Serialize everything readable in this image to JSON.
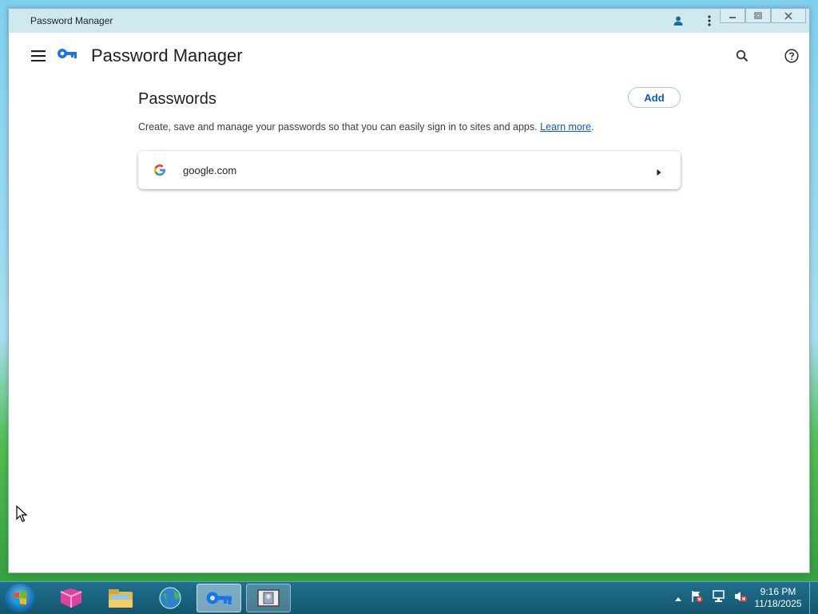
{
  "window": {
    "title": "Password Manager",
    "controls": {
      "minimize": "minimize-icon",
      "restore": "restore-icon",
      "close": "close-icon"
    }
  },
  "header": {
    "menu_icon": "hamburger-menu-icon",
    "logo_icon": "key-icon",
    "title": "Password Manager",
    "search_icon": "search-icon",
    "help_icon": "help-icon"
  },
  "main": {
    "section_title": "Passwords",
    "add_label": "Add",
    "description": "Create, save and manage your passwords so that you can easily sign in to sites and apps.",
    "learn_more": "Learn more",
    "description_end": ".",
    "passwords": [
      {
        "site": "google.com",
        "icon": "google-g-icon"
      }
    ]
  },
  "taskbar": {
    "apps": [
      "start-orb-icon",
      "pink-app-icon",
      "file-explorer-icon",
      "browser-globe-icon",
      "password-manager-key-icon",
      "window-preview-icon"
    ],
    "time": "9:16 PM",
    "date": "11/18/2025"
  },
  "colors": {
    "accent": "#0b57d0",
    "key_blue": "#1a73e8",
    "titlebar": "#cfe9f1",
    "taskbar": "#1a6482"
  }
}
